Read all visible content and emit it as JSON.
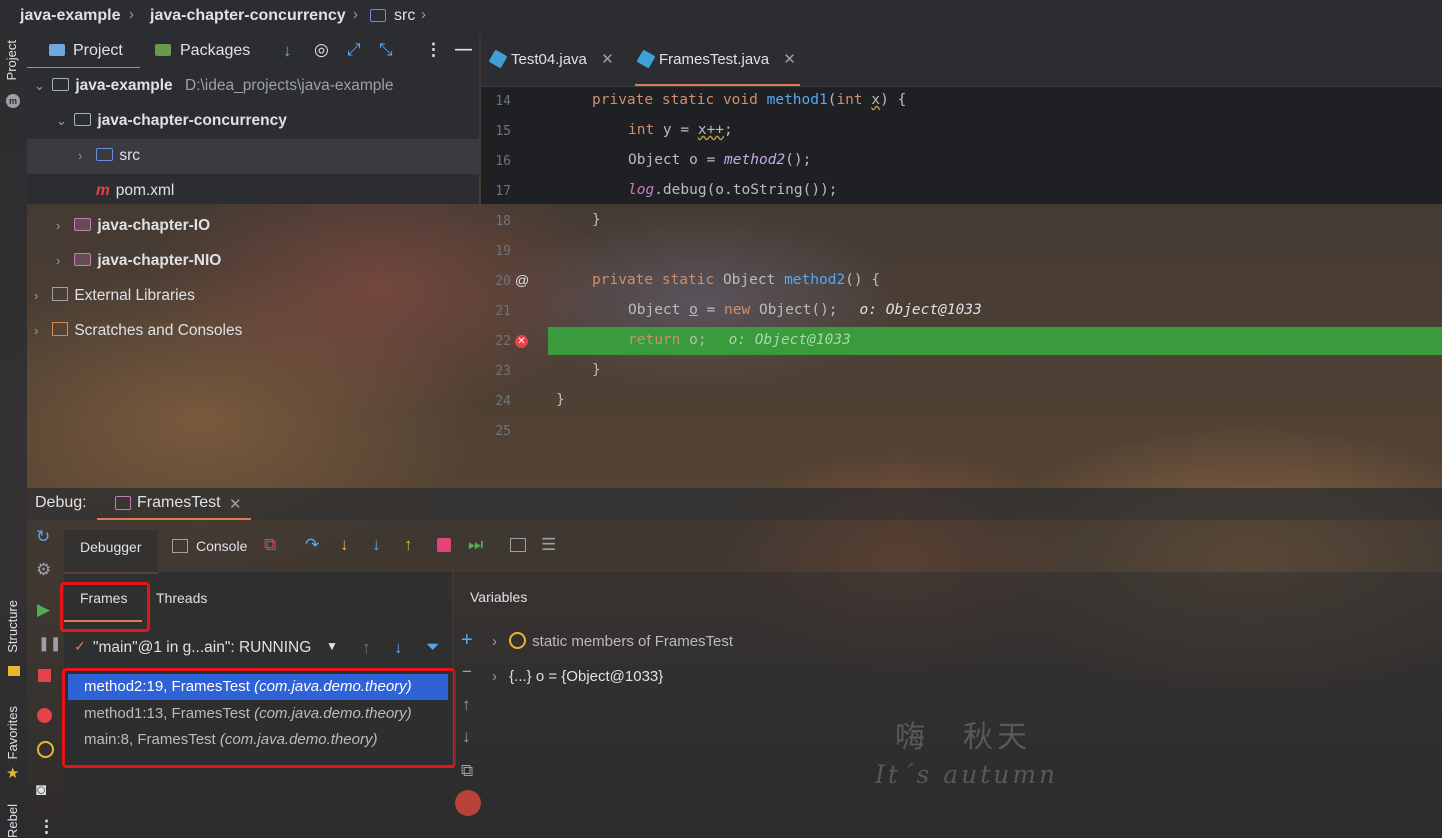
{
  "breadcrumb": [
    "java-example",
    "java-chapter-concurrency",
    "src"
  ],
  "project_panel": {
    "tabs": [
      "Project",
      "Packages"
    ],
    "side_label": "Project",
    "tree": [
      {
        "name": "java-example",
        "path": "D:\\idea_projects\\java-example"
      },
      {
        "name": "java-chapter-concurrency"
      },
      {
        "name": "src"
      },
      {
        "name": "pom.xml"
      },
      {
        "name": "java-chapter-IO"
      },
      {
        "name": "java-chapter-NIO"
      },
      {
        "name": "External Libraries"
      },
      {
        "name": "Scratches and Consoles"
      }
    ]
  },
  "editor": {
    "tabs": [
      "Test04.java",
      "FramesTest.java"
    ],
    "line_numbers": [
      "14",
      "15",
      "16",
      "17",
      "18",
      "19",
      "20",
      "21",
      "22",
      "23",
      "24",
      "25"
    ],
    "lines": {
      "l14a": "private static void ",
      "l14b": "method1",
      "l14c": "(",
      "l14d": "int ",
      "l14e": "x",
      "l14f": ") {",
      "l15a": "int ",
      "l15b": "y = ",
      "l15c": "x++",
      "l15d": ";",
      "l16a": "Object o = ",
      "l16b": "method2",
      "l16c": "();",
      "l17a": "log",
      "l17b": ".debug(o.toString());",
      "l18": "}",
      "l20a": "private static ",
      "l20b": "Object ",
      "l20c": "method2",
      "l20d": "() {",
      "l21a": "Object ",
      "l21b": "o",
      "l21c": " = ",
      "l21d": "new ",
      "l21e": "Object();",
      "l21f": "o: Object@1033",
      "l22a": "return ",
      "l22b": "o;",
      "l22c": "o: Object@1033",
      "l23": "}",
      "l24": "}"
    },
    "gutter_at": "@"
  },
  "debug": {
    "label": "Debug:",
    "session_tab": "FramesTest",
    "tabs": [
      "Debugger",
      "Console"
    ],
    "subtabs": [
      "Frames",
      "Threads"
    ],
    "variables_title": "Variables",
    "thread_selector": "\"main\"@1 in g...ain\": RUNNING",
    "frames": [
      {
        "method": "method2:19, FramesTest",
        "pkg": "(com.java.demo.theory)"
      },
      {
        "method": "method1:13, FramesTest",
        "pkg": "(com.java.demo.theory)"
      },
      {
        "method": "main:8, FramesTest",
        "pkg": "(com.java.demo.theory)"
      }
    ],
    "variables": [
      {
        "label": "static members of FramesTest"
      },
      {
        "label": "{...} o = {Object@1033}"
      }
    ]
  },
  "side_tools": [
    "Structure",
    "Favorites",
    "Rebel"
  ],
  "watermark": {
    "line1": "嗨　秋天",
    "line2": "It´s autumn"
  },
  "colors": {
    "selection": "#2e62d6",
    "breakpoint_line": "#3a9b3c",
    "highlight_box": "#e4141b"
  }
}
